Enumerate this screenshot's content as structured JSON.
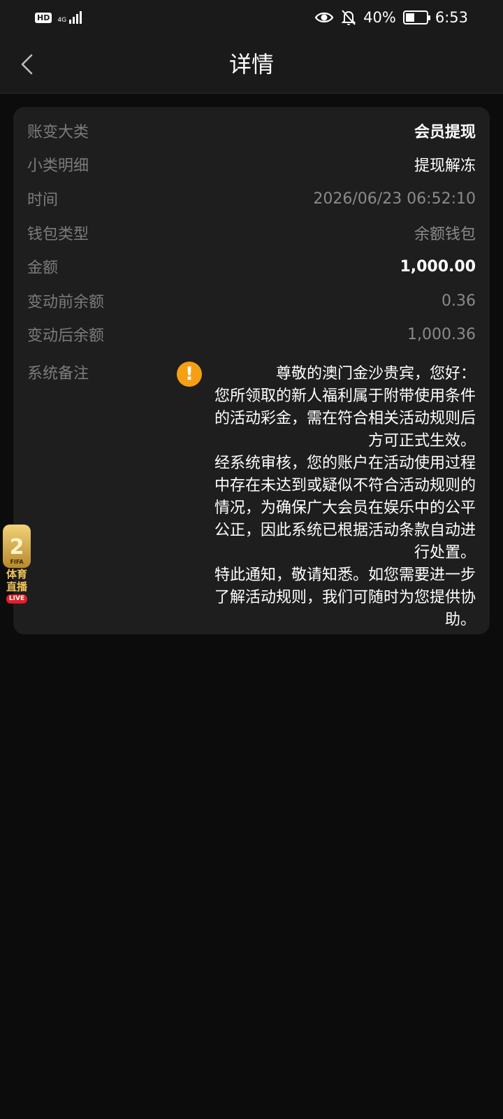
{
  "status_bar": {
    "hd": "HD",
    "network": "4G",
    "battery": "40%",
    "time": "6:53",
    "icons": [
      "eye-icon",
      "bell-off-icon",
      "battery-charging-icon",
      "signal-icon"
    ]
  },
  "nav": {
    "title": "详情",
    "back_icon": "chevron-left-icon"
  },
  "details": {
    "rows": [
      {
        "label": "账变大类",
        "value": "会员提现"
      },
      {
        "label": "小类明细",
        "value": "提现解冻"
      },
      {
        "label": "时间",
        "value": "2026/06/23 06:52:10"
      },
      {
        "label": "钱包类型",
        "value": "余额钱包"
      },
      {
        "label": "金额",
        "value": "1,000.00"
      },
      {
        "label": "变动前余额",
        "value": "0.36"
      },
      {
        "label": "变动后余额",
        "value": "1,000.36"
      }
    ],
    "remark_label": "系统备注",
    "remark_icon": "warning-icon",
    "remark_text": "尊敬的澳门金沙贵宾，您好：\n您所领取的新人福利属于附带使用条件的活动彩金，需在符合相关活动规则后方可正式生效。\n经系统审核，您的账户在活动使用过程中存在未达到或疑似不符合活动规则的情况，为确保广大会员在娱乐中的公平公正，因此系统已根据活动条款自动进行处置。\n特此通知，敬请知悉。如您需要进一步了解活动规则，我们可随时为您提供协助。"
  },
  "floating_badge": {
    "fifa": "FIFA",
    "label_line1": "体育",
    "label_line2": "直播",
    "live": "LIVE"
  },
  "colors": {
    "background": "#0c0c0c",
    "card": "#1e1e1e",
    "label": "#7c7c7c",
    "warning": "#f5a014"
  }
}
